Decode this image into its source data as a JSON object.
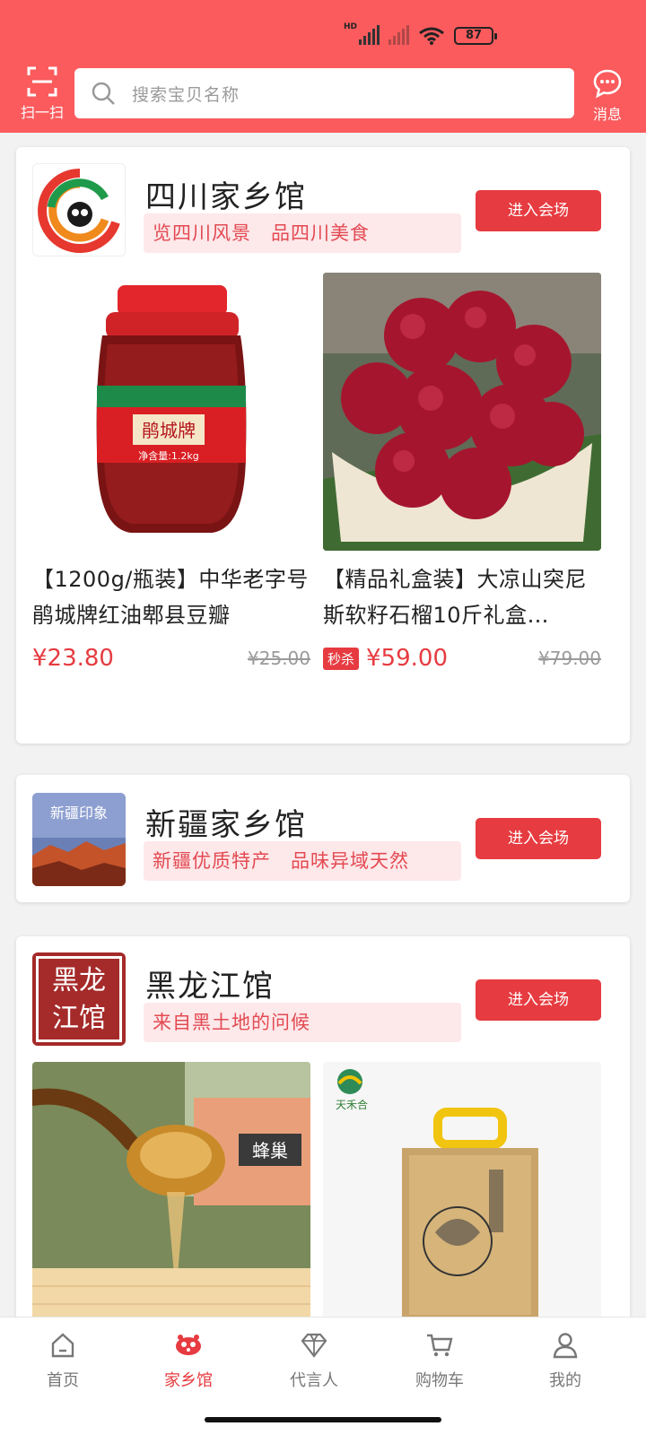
{
  "status_bar": {
    "hd": "HD",
    "battery": "87"
  },
  "header": {
    "scan_label": "扫一扫",
    "search_placeholder": "搜索宝贝名称",
    "message_label": "消息"
  },
  "halls": [
    {
      "name": "四川家乡馆",
      "slogan": "览四川风景　品四川美食",
      "enter_label": "进入会场",
      "products": [
        {
          "title": "【1200g/瓶装】中华老字号 鹃城牌红油郫县豆瓣",
          "badge": "",
          "price": "¥23.80",
          "original_price": "¥25.00"
        },
        {
          "title": "【精品礼盒装】大凉山突尼斯软籽石榴10斤礼盒…",
          "badge": "秒杀",
          "price": "¥59.00",
          "original_price": "¥79.00"
        }
      ]
    },
    {
      "name": "新疆家乡馆",
      "slogan": "新疆优质特产　品味异域天然",
      "enter_label": "进入会场",
      "logo_text": "新疆印象"
    },
    {
      "name": "黑龙江馆",
      "slogan": "来自黑土地的问候",
      "enter_label": "进入会场",
      "logo_text_line1": "黑龙",
      "logo_text_line2": "江馆",
      "products": [
        {
          "image_text": "蜂巢"
        },
        {
          "image_text": "天禾合"
        }
      ]
    }
  ],
  "tabbar": {
    "items": [
      {
        "label": "首页",
        "icon": "home-icon"
      },
      {
        "label": "家乡馆",
        "icon": "hometown-icon",
        "active": true
      },
      {
        "label": "代言人",
        "icon": "diamond-icon"
      },
      {
        "label": "购物车",
        "icon": "cart-icon"
      },
      {
        "label": "我的",
        "icon": "user-icon"
      }
    ]
  },
  "colors": {
    "header": "#fb5b5d",
    "accent": "#e63b40",
    "slogan_bg": "#fde8ea"
  }
}
